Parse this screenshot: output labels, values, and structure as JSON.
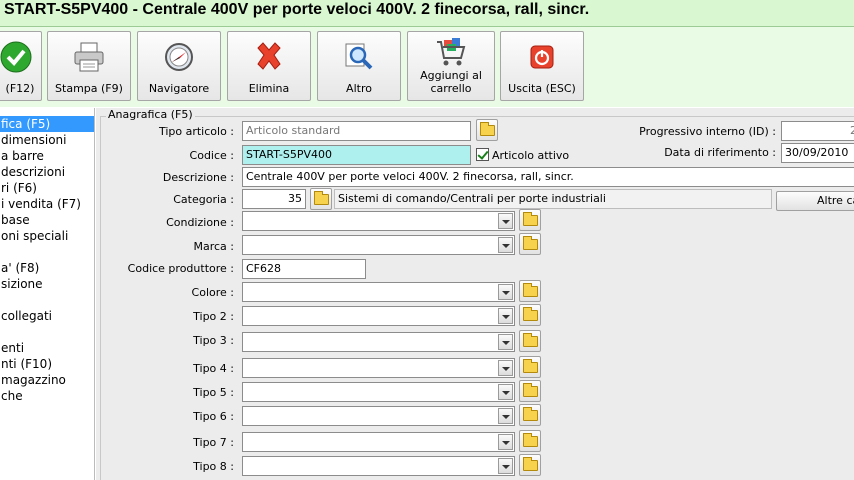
{
  "window": {
    "title": "START-S5PV400 - Centrale 400V per porte veloci 400V. 2 finecorsa, rall, sincr."
  },
  "toolbar": {
    "buttons": [
      {
        "label": "(F12)",
        "icon": "check-icon"
      },
      {
        "label": "Stampa (F9)",
        "icon": "printer-icon"
      },
      {
        "label": "Navigatore",
        "icon": "compass-icon"
      },
      {
        "label": "Elimina",
        "icon": "delete-x-icon"
      },
      {
        "label": "Altro",
        "icon": "magnifier-icon"
      },
      {
        "label": "Aggiungi al carrello",
        "icon": "cart-icon"
      },
      {
        "label": "Uscita (ESC)",
        "icon": "power-icon"
      }
    ]
  },
  "sidebar": {
    "items": [
      {
        "label": "fica (F5)",
        "selected": true
      },
      {
        "label": "dimensioni"
      },
      {
        "label": "a barre"
      },
      {
        "label": "descrizioni"
      },
      {
        "label": "ri (F6)"
      },
      {
        "label": "i vendita (F7)"
      },
      {
        "label": "base"
      },
      {
        "label": "oni speciali"
      },
      {
        "label": ""
      },
      {
        "label": "a' (F8)"
      },
      {
        "label": "sizione"
      },
      {
        "label": ""
      },
      {
        "label": "collegati"
      },
      {
        "label": ""
      },
      {
        "label": "enti"
      },
      {
        "label": "nti (F10)"
      },
      {
        "label": "magazzino"
      },
      {
        "label": "che"
      }
    ]
  },
  "form": {
    "group_title": "Anagrafica (F5)",
    "tipo_articolo": {
      "label": "Tipo articolo :",
      "value": "Articolo standard"
    },
    "codice": {
      "label": "Codice :",
      "value": "START-S5PV400"
    },
    "articolo_attivo": {
      "label": "Articolo attivo",
      "checked": true
    },
    "descrizione": {
      "label": "Descrizione :",
      "value": "Centrale 400V per porte veloci 400V. 2 finecorsa, rall, sincr."
    },
    "categoria": {
      "label": "Categoria :",
      "code": "35",
      "description": "Sistemi di comando/Centrali per porte industriali"
    },
    "altre_categorie": {
      "label": "Altre ca"
    },
    "condizione": {
      "label": "Condizione :",
      "value": ""
    },
    "marca": {
      "label": "Marca :",
      "value": ""
    },
    "codice_produttore": {
      "label": "Codice produttore :",
      "value": "CF628"
    },
    "colore": {
      "label": "Colore :",
      "value": ""
    },
    "tipo2": {
      "label": "Tipo 2 :",
      "value": ""
    },
    "tipo3": {
      "label": "Tipo 3 :",
      "value": ""
    },
    "tipo4": {
      "label": "Tipo 4 :",
      "value": ""
    },
    "tipo5": {
      "label": "Tipo 5 :",
      "value": ""
    },
    "tipo6": {
      "label": "Tipo 6 :",
      "value": ""
    },
    "tipo7": {
      "label": "Tipo 7 :",
      "value": ""
    },
    "tipo8": {
      "label": "Tipo 8 :",
      "value": ""
    },
    "progressivo": {
      "label": "Progressivo interno (ID) :",
      "value": "2"
    },
    "data_riferimento": {
      "label": "Data di riferimento :",
      "value": "30/09/2010"
    }
  }
}
